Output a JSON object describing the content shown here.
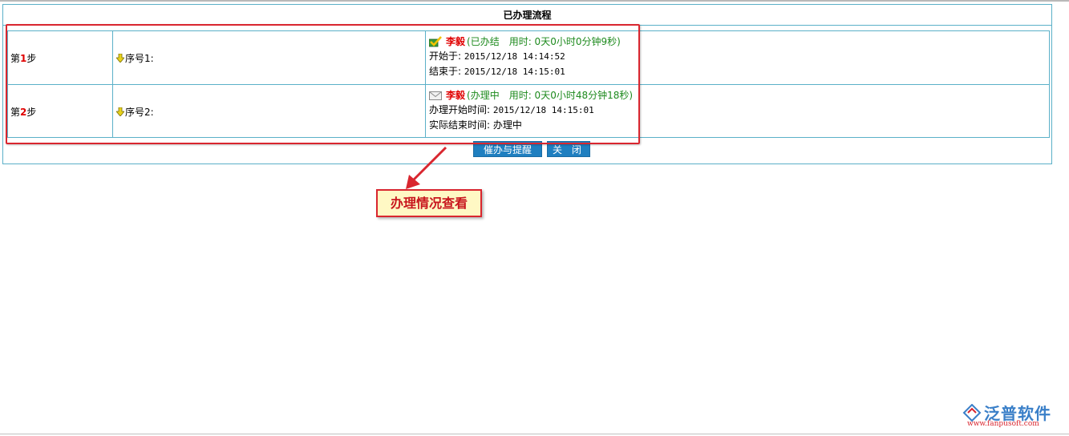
{
  "page": {
    "title": "已办理流程"
  },
  "steps": [
    {
      "label_prefix": "第",
      "label_num": "1",
      "label_suffix": "步",
      "seq": "序号1:",
      "status_icon": "check-icon",
      "handler": "李毅",
      "status": "(已办结　用时: 0天0小时0分钟9秒)",
      "line1_label": "开始于: ",
      "line1_value": "2015/12/18 14:14:52",
      "line2_label": "结束于: ",
      "line2_value": "2015/12/18 14:15:01"
    },
    {
      "label_prefix": "第",
      "label_num": "2",
      "label_suffix": "步",
      "seq": "序号2:",
      "status_icon": "envelope-icon",
      "handler": "李毅",
      "status": "(办理中　用时: 0天0小时48分钟18秒)",
      "line1_label": "办理开始时间: ",
      "line1_value": "2015/12/18 14:15:01",
      "line2_label": "实际结束时间: ",
      "line2_value": "办理中"
    }
  ],
  "buttons": {
    "remind": "催办与提醒",
    "close": "关 闭"
  },
  "annotation": {
    "callout": "办理情况查看"
  },
  "logo": {
    "brand": "泛普软件",
    "url": "www.fanpusoft.com"
  }
}
